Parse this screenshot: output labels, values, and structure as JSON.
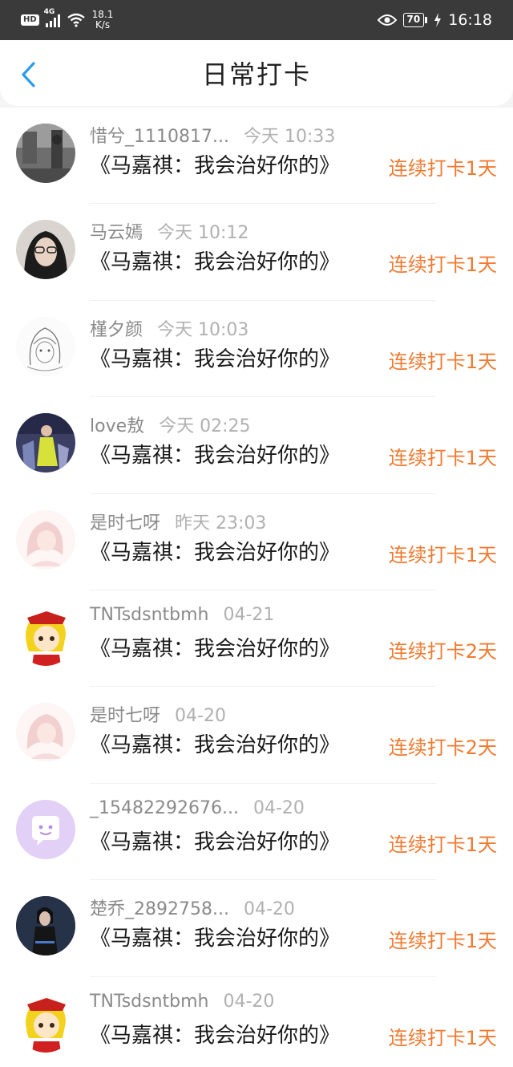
{
  "status_bar": {
    "hd": "HD",
    "network": "4G",
    "speed_value": "18.1",
    "speed_unit": "K/s",
    "battery": "70",
    "time": "16:18"
  },
  "header": {
    "title": "日常打卡",
    "back_icon": "chevron-left-icon"
  },
  "colors": {
    "accent_blue": "#2b9bea",
    "streak_orange": "#f07a30"
  },
  "checkins": [
    {
      "name": "惜兮_1110817...",
      "time": "今天 10:33",
      "content": "《马嘉祺：我会治好你的》",
      "streak": "连续打卡1天",
      "avatar": "photo-avatar"
    },
    {
      "name": "马云嫣",
      "time": "今天 10:12",
      "content": "《马嘉祺：我会治好你的》",
      "streak": "连续打卡1天",
      "avatar": "photo-avatar"
    },
    {
      "name": "槿夕颜",
      "time": "今天 10:03",
      "content": "《马嘉祺：我会治好你的》",
      "streak": "连续打卡1天",
      "avatar": "sketch-avatar"
    },
    {
      "name": "love敖",
      "time": "今天 02:25",
      "content": "《马嘉祺：我会治好你的》",
      "streak": "连续打卡1天",
      "avatar": "photo-avatar"
    },
    {
      "name": "是时七呀",
      "time": "昨天 23:03",
      "content": "《马嘉祺：我会治好你的》",
      "streak": "连续打卡1天",
      "avatar": "anime-avatar"
    },
    {
      "name": "TNTsdsntbmh",
      "time": "04-21",
      "content": "《马嘉祺：我会治好你的》",
      "streak": "连续打卡2天",
      "avatar": "cartoon-avatar"
    },
    {
      "name": "是时七呀",
      "time": "04-20",
      "content": "《马嘉祺：我会治好你的》",
      "streak": "连续打卡2天",
      "avatar": "anime-avatar"
    },
    {
      "name": "_15482292676...",
      "time": "04-20",
      "content": "《马嘉祺：我会治好你的》",
      "streak": "连续打卡1天",
      "avatar": "default-chat-avatar"
    },
    {
      "name": "楚乔_2892758...",
      "time": "04-20",
      "content": "《马嘉祺：我会治好你的》",
      "streak": "连续打卡1天",
      "avatar": "photo-avatar"
    },
    {
      "name": "TNTsdsntbmh",
      "time": "04-20",
      "content": "《马嘉祺：我会治好你的》",
      "streak": "连续打卡1天",
      "avatar": "cartoon-avatar"
    }
  ]
}
